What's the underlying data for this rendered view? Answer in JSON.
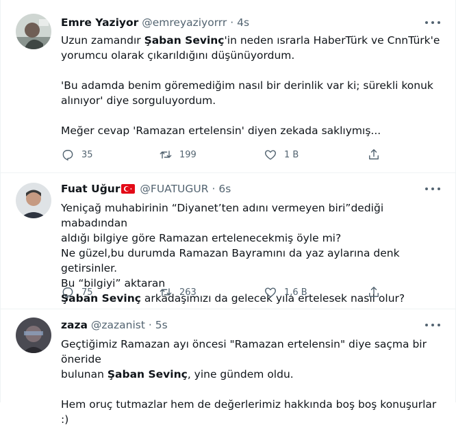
{
  "tweets": [
    {
      "name": "Emre Yaziyor",
      "handle": "@emreyaziyorrr",
      "dot": "·",
      "time": "4s",
      "body": {
        "l1a": "Uzun zamandır ",
        "l1b": "Şaban Sevinç",
        "l1c": "'in neden ısrarla HaberTürk ve CnnTürk'e",
        "l2": "yorumcu olarak çıkarıldığını düşünüyordum.",
        "l3": "'Bu adamda benim göremediğim nasıl bir derinlik var ki; sürekli konuk",
        "l4": "alınıyor' diye sorguluyordum.",
        "l5": "Meğer cevap 'Ramazan ertelensin' diyen zekada saklıymış..."
      },
      "replies": "35",
      "retweets": "199",
      "likes": "1 B"
    },
    {
      "name": "Fuat Uğur",
      "handle": "@FUATUGUR",
      "dot": "·",
      "time": "6s",
      "body": {
        "l1": "Yeniçağ muhabirinin “Diyanet’ten adını vermeyen biri”dediği mabadından",
        "l2": "aldığı bilgiye göre Ramazan ertelenecekmiş öyle mi?",
        "l3": "Ne güzel,bu durumda Ramazan Bayramını da yaz aylarına denk getirsinler.",
        "l4": "Bu “bilgiyi” aktaran",
        "l5a": "Şaban Sevinç",
        "l5b": " arkadaşımızı da gelecek yıla ertelesek nasıl olur?"
      },
      "replies": "75",
      "retweets": "263",
      "likes": "1,6 B"
    },
    {
      "name": "zaza",
      "handle": "@zazanist",
      "dot": "·",
      "time": "5s",
      "body": {
        "l1": "Geçtiğimiz Ramazan ayı öncesi \"Ramazan ertelensin\" diye saçma bir öneride",
        "l2a": "bulunan ",
        "l2b": "Şaban Sevinç",
        "l2c": ", yine gündem oldu.",
        "l3": "Hem oruç tutmazlar hem de değerlerimiz hakkında boş boş konuşurlar :)"
      }
    }
  ],
  "icons": [
    "reply-icon",
    "retweet-icon",
    "like-icon",
    "share-icon",
    "more-icon",
    "turkey-flag-icon"
  ],
  "colors": {
    "secondary_text": "#536471",
    "divider": "#eff3f4",
    "flag_red": "#e30a17"
  }
}
